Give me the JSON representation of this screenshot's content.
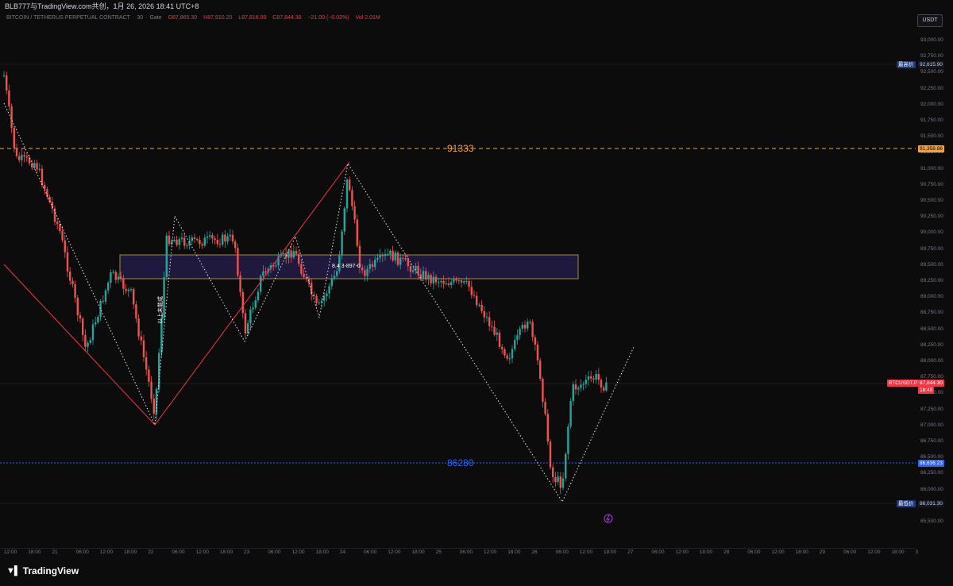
{
  "header": {
    "watermark": "BLB777与TradingView.com共创，1月 26, 2026 18:41 UTC+8"
  },
  "ohlc": {
    "symbol": "BITCOIN / TETHERUS PERPETUAL CONTRACT",
    "interval": "30",
    "exchange": "Gate",
    "open": "O87,865.30",
    "high": "H87,910.20",
    "low": "L87,816.00",
    "close": "C87,844.30",
    "change": "−21.00 (−0.02%)",
    "volume": "Vol 2.01M"
  },
  "currency_button": "USDT",
  "levels": {
    "resistance": "91333",
    "support": "86280",
    "box_label": "8.4 3-897-0",
    "annotation": "以上未能成"
  },
  "price_axis": {
    "labels": [
      "93,000.00",
      "92,750.00",
      "92,500.00",
      "92,250.00",
      "92,000.00",
      "91,750.00",
      "91,500.00",
      "91,250.00",
      "91,000.00",
      "90,750.00",
      "90,500.00",
      "90,250.00",
      "90,000.00",
      "89,750.00",
      "89,500.00",
      "89,250.00",
      "89,000.00",
      "88,750.00",
      "88,500.00",
      "88,250.00",
      "88,000.00",
      "87,750.00",
      "87,500.00",
      "87,250.00",
      "87,000.00",
      "86,750.00",
      "86,500.00",
      "86,250.00",
      "86,000.00",
      "85,750.00",
      "85,500.00"
    ],
    "high_tag_label": "最高价",
    "high_tag_value": "92,615.90",
    "res_tag_value": "91,358.86",
    "symbol_tag": "BTCUSDT.P",
    "last_price": "87,844.30",
    "countdown": "18:48",
    "sup_tag_value": "86,636.23",
    "low_tag_label": "最低价",
    "low_tag_value": "86,031.30"
  },
  "time_axis": {
    "labels": [
      "12:00",
      "18:00",
      "21",
      "06:00",
      "12:00",
      "18:00",
      "22",
      "06:00",
      "12:00",
      "18:00",
      "23",
      "06:00",
      "12:00",
      "18:00",
      "24",
      "06:00",
      "12:00",
      "18:00",
      "25",
      "06:00",
      "12:00",
      "18:00",
      "26",
      "06:00",
      "12:00",
      "18:00",
      "27",
      "06:00",
      "12:00",
      "18:00",
      "28",
      "06:00",
      "12:00",
      "18:00",
      "29",
      "06:00",
      "12:00",
      "18:00",
      "3"
    ]
  },
  "colors": {
    "up": "#26a69a",
    "down": "#ef5350",
    "orange": "#f7a33a",
    "blue": "#2962ff",
    "box_border": "#c8a94a",
    "box_fill": "#231c48"
  },
  "footer": {
    "logo_text": "TradingView"
  }
}
